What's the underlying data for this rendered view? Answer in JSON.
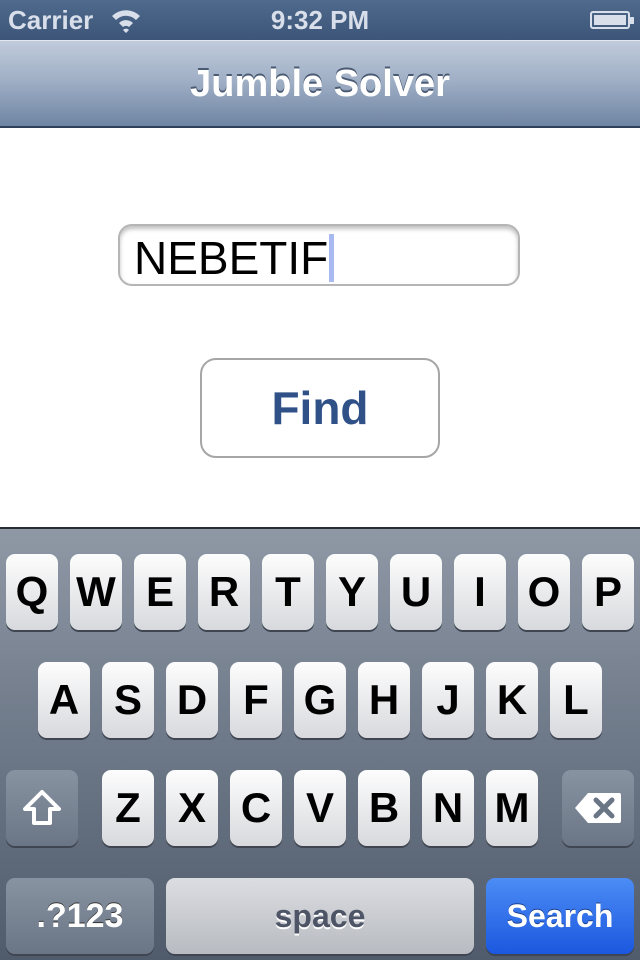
{
  "status_bar": {
    "carrier": "Carrier",
    "wifi_icon": "wifi-icon",
    "time": "9:32 PM",
    "battery_icon": "battery-icon"
  },
  "nav_bar": {
    "title": "Jumble Solver"
  },
  "main": {
    "input_value": "NEBETIF",
    "find_button_label": "Find"
  },
  "keyboard": {
    "row1": [
      "Q",
      "W",
      "E",
      "R",
      "T",
      "Y",
      "U",
      "I",
      "O",
      "P"
    ],
    "row2": [
      "A",
      "S",
      "D",
      "F",
      "G",
      "H",
      "J",
      "K",
      "L"
    ],
    "row3": [
      "Z",
      "X",
      "C",
      "V",
      "B",
      "N",
      "M"
    ],
    "shift_icon": "shift-arrow-icon",
    "delete_icon": "backspace-icon",
    "mode_label": ".?123",
    "space_label": "space",
    "return_label": "Search"
  },
  "colors": {
    "nav_accent": "#3c5578",
    "button_text": "#2f5188",
    "search_key": "#1b58df",
    "caret": "#a9b9f2"
  }
}
